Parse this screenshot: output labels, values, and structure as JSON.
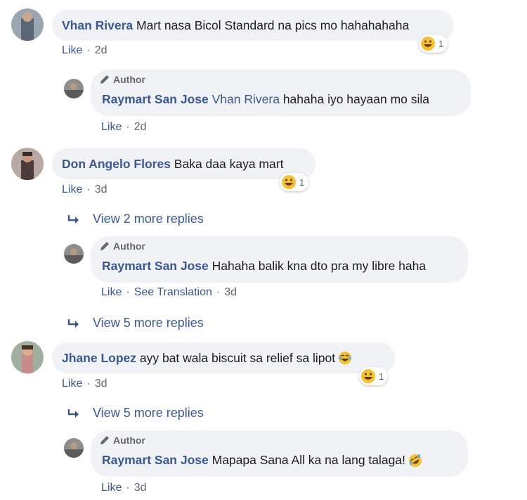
{
  "comments": [
    {
      "author": "Vhan Rivera",
      "text": "Mart nasa Bicol Standard na pics mo hahahahaha",
      "like": "Like",
      "time": "2d",
      "reaction_count": "1",
      "avatar_color": "#6b7b8c"
    },
    {
      "author": "Don Angelo Flores",
      "text": "Baka daa kaya mart",
      "like": "Like",
      "time": "3d",
      "reaction_count": "1",
      "avatar_color": "#8a6f6a"
    },
    {
      "author": "Jhane Lopez",
      "text": "ayy bat wala biscuit sa relief sa lipot",
      "like": "Like",
      "time": "3d",
      "reaction_count": "1",
      "avatar_color": "#7a8a78"
    }
  ],
  "replies": [
    {
      "badge": "Author",
      "author": "Raymart San Jose",
      "mention": "Vhan Rivera",
      "text": "hahaha iyo hayaan mo sila",
      "like": "Like",
      "time": "2d"
    },
    {
      "badge": "Author",
      "author": "Raymart San Jose",
      "text": "Hahaha balik kna dto pra my libre haha",
      "like": "Like",
      "translation": "See Translation",
      "time": "3d"
    },
    {
      "badge": "Author",
      "author": "Raymart San Jose",
      "text": "Mapapa Sana All ka na lang talaga!",
      "like": "Like",
      "time": "3d"
    }
  ],
  "view_replies": [
    "View 2 more replies",
    "View 5 more replies",
    "View 5 more replies"
  ],
  "separator": "·",
  "colors": {
    "link": "#385898",
    "bubble": "#f0f2f5",
    "meta": "#606770",
    "emoji": "#f7c12e"
  },
  "icons": {
    "laugh": "laugh-emoji-icon",
    "pencil": "pencil-icon",
    "reply_arrow": "reply-arrow-icon",
    "tears": "tears-of-joy-emoji-icon",
    "rofl": "rolling-laughing-emoji-icon"
  }
}
